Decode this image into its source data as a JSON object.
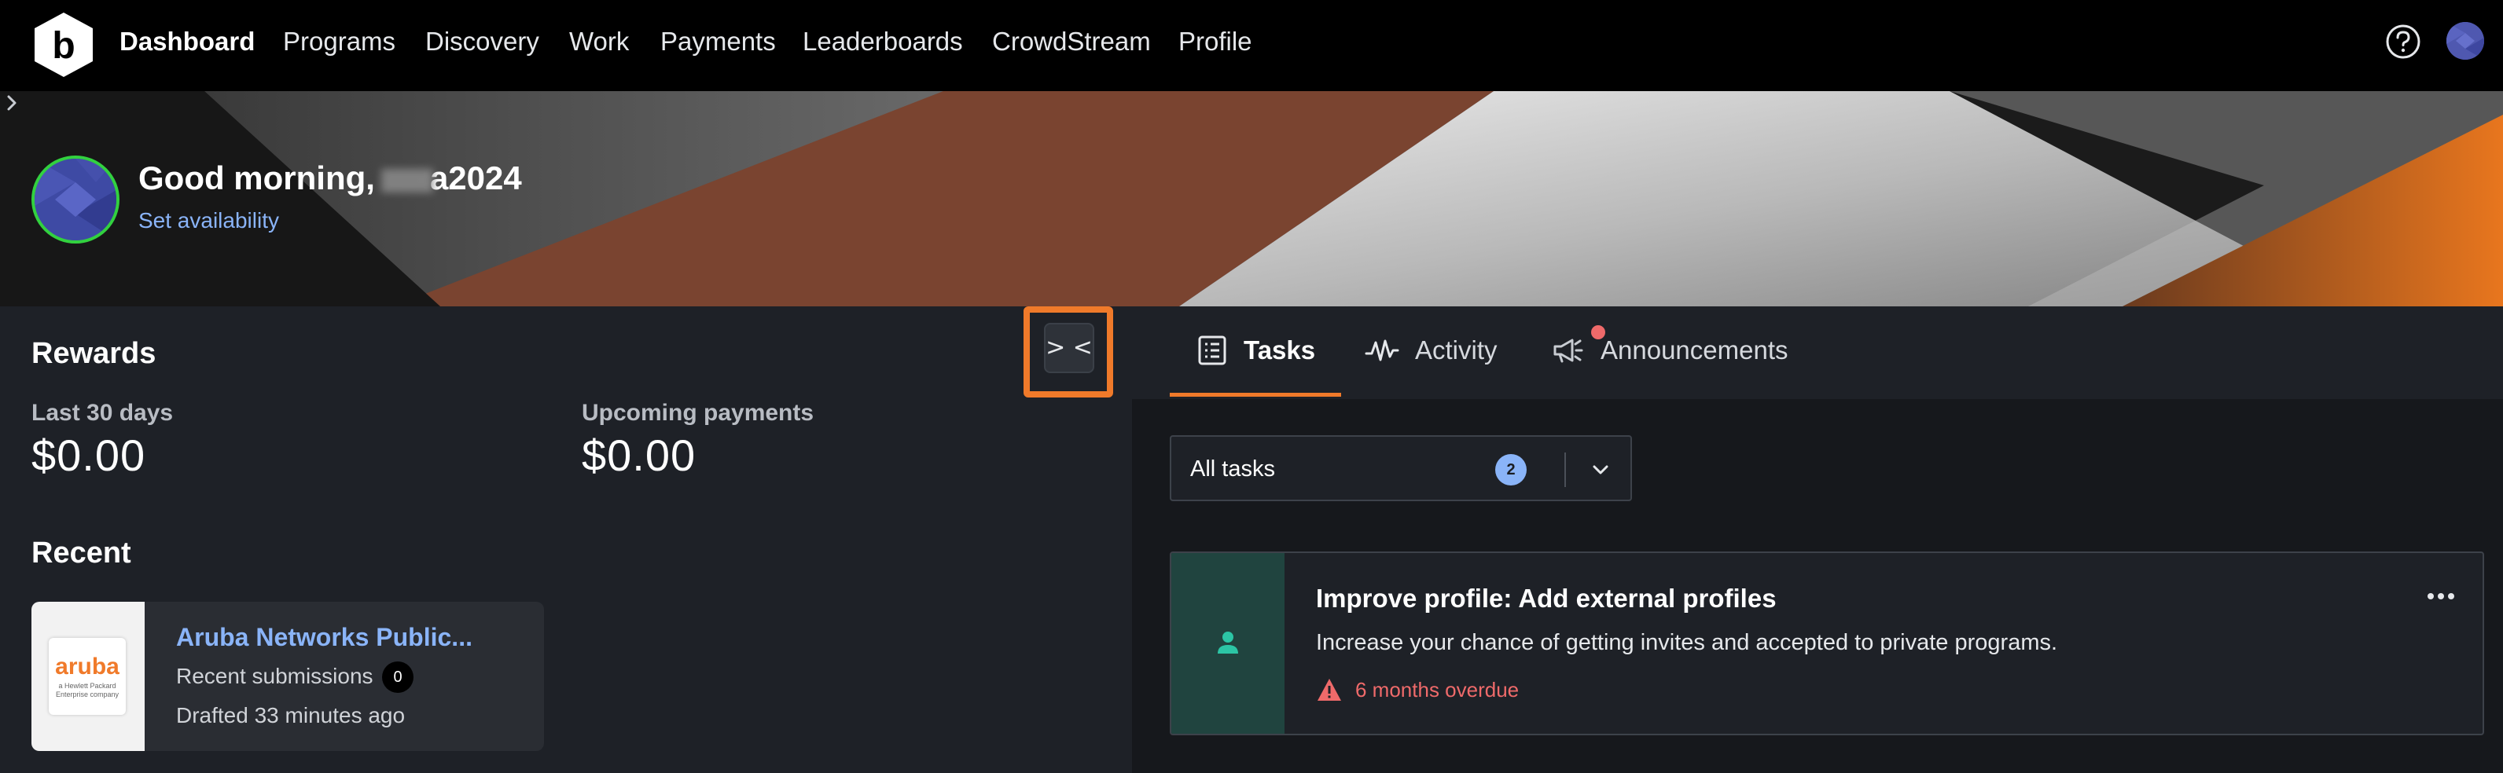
{
  "nav": {
    "items": [
      {
        "label": "Dashboard",
        "active": true
      },
      {
        "label": "Programs"
      },
      {
        "label": "Discovery"
      },
      {
        "label": "Work"
      },
      {
        "label": "Payments"
      },
      {
        "label": "Leaderboards"
      },
      {
        "label": "CrowdStream"
      },
      {
        "label": "Profile"
      }
    ],
    "icons": [
      "bugcrowd-logo-icon",
      "help-icon",
      "user-avatar"
    ]
  },
  "hero": {
    "greeting_prefix": "Good morning,",
    "username_suffix": "a2024",
    "availability_label": "Set availability"
  },
  "rewards": {
    "title": "Rewards",
    "last_30_label": "Last 30 days",
    "last_30_value": "$0.00",
    "upcoming_label": "Upcoming payments",
    "upcoming_value": "$0.00",
    "collapse_label": "> <"
  },
  "recent": {
    "title": "Recent",
    "card": {
      "logo_brand": "aruba",
      "logo_sub": "a Hewlett Packard Enterprise company",
      "name": "Aruba Networks Public...",
      "submissions_label": "Recent submissions",
      "submissions_count": "0",
      "drafted": "Drafted 33 minutes ago"
    }
  },
  "tabs": {
    "items": [
      {
        "label": "Tasks",
        "active": true,
        "icon": "list-icon"
      },
      {
        "label": "Activity",
        "icon": "pulse-icon"
      },
      {
        "label": "Announcements",
        "icon": "megaphone-icon",
        "notification": true
      }
    ]
  },
  "filter": {
    "label": "All tasks",
    "count": "2"
  },
  "task": {
    "title": "Improve profile: Add external profiles",
    "description": "Increase your chance of getting invites and accepted to private programs.",
    "overdue": "6 months overdue"
  },
  "colors": {
    "accent": "#f07a2a",
    "link": "#8ab4f8",
    "warning": "#ef6a6a",
    "online": "#32d13f",
    "task_side": "#20443f"
  }
}
